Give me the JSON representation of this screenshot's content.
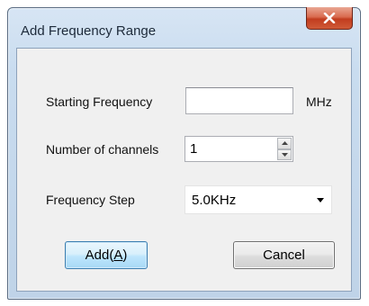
{
  "window": {
    "title": "Add Frequency Range",
    "close_icon": "close-icon"
  },
  "form": {
    "starting_frequency": {
      "label": "Starting Frequency",
      "value": "",
      "unit": "MHz"
    },
    "num_channels": {
      "label": "Number of channels",
      "value": "1"
    },
    "frequency_step": {
      "label": "Frequency Step",
      "selected": "5.0KHz"
    }
  },
  "buttons": {
    "add_prefix": "Add(",
    "add_accel": "A",
    "add_suffix": ")",
    "cancel": "Cancel"
  },
  "icons": {
    "close": "close-icon",
    "spin_up": "spin-up-icon",
    "spin_down": "spin-down-icon",
    "dropdown": "dropdown-arrow-icon"
  }
}
